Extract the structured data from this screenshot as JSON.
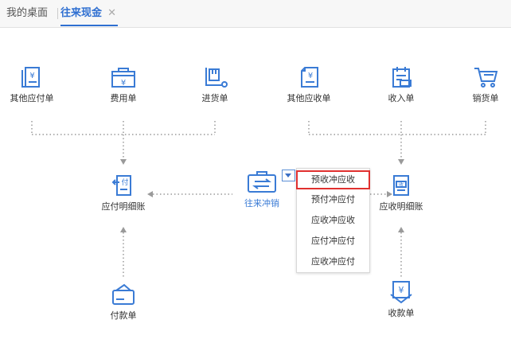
{
  "tabs": {
    "home": "我的桌面",
    "active": "往来现金",
    "close": "✕"
  },
  "nodes": {
    "other_payable": "其他应付单",
    "expense": "费用单",
    "purchase": "进货单",
    "other_receivable": "其他应收单",
    "income": "收入单",
    "sales": "销货单",
    "payable_detail": "应付明细账",
    "offset": "往来冲销",
    "receivable_detail": "应收明细账",
    "payment": "付款单",
    "receipt": "收款单"
  },
  "menu": {
    "items": [
      "预收冲应收",
      "预付冲应付",
      "应收冲应收",
      "应付冲应付",
      "应收冲应付"
    ],
    "selected_index": 0
  },
  "colors": {
    "accent": "#2f6fd1",
    "highlight": "#e0302f",
    "icon": "#3a7bd5"
  }
}
